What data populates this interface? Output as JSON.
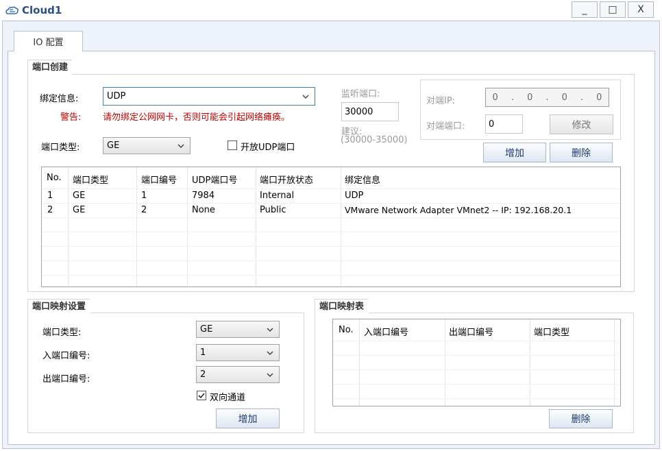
{
  "window": {
    "title": "Cloud1",
    "minimize": "_",
    "restore": "□",
    "close": "X"
  },
  "tabs": [
    {
      "label": "IO 配置"
    }
  ],
  "port_create": {
    "title": "端口创建",
    "bind_label": "绑定信息:",
    "bind_value": "UDP",
    "warning_label": "警告:",
    "warning_text": "请勿绑定公网网卡，否则可能会引起网络瘫痪。",
    "port_type_label": "端口类型:",
    "port_type_value": "GE",
    "open_udp_label": "开放UDP端口",
    "open_udp_checked": false,
    "listen_port_label": "监听端口:",
    "listen_port_value": "30000",
    "suggest_label": "建议:",
    "suggest_range": "(30000-35000)",
    "peer_ip_label": "对端IP:",
    "peer_ip": [
      "0",
      "0",
      "0",
      "0"
    ],
    "peer_port_label": "对端端口:",
    "peer_port_value": "0",
    "modify_button": "修改",
    "add_button": "增加",
    "delete_button": "删除",
    "table": {
      "headers": [
        "No.",
        "端口类型",
        "端口编号",
        "UDP端口号",
        "端口开放状态",
        "绑定信息"
      ],
      "rows": [
        [
          "1",
          "GE",
          "1",
          "7984",
          "Internal",
          "UDP"
        ],
        [
          "2",
          "GE",
          "2",
          "None",
          "Public",
          "VMware Network Adapter VMnet2 -- IP: 192.168.20.1"
        ]
      ]
    }
  },
  "port_mapping": {
    "title": "端口映射设置",
    "port_type_label": "端口类型:",
    "port_type_value": "GE",
    "in_port_label": "入端口编号:",
    "in_port_value": "1",
    "out_port_label": "出端口编号:",
    "out_port_value": "2",
    "bidirectional_label": "双向通道",
    "bidirectional_checked": true,
    "add_button": "增加"
  },
  "mapping_table": {
    "title": "端口映射表",
    "headers": [
      "No.",
      "入端口编号",
      "出端口编号",
      "端口类型"
    ],
    "rows": [],
    "delete_button": "删除"
  },
  "colors": {
    "accent": "#2b4f88",
    "warning": "#c00000",
    "frame": "#eef3fb"
  }
}
